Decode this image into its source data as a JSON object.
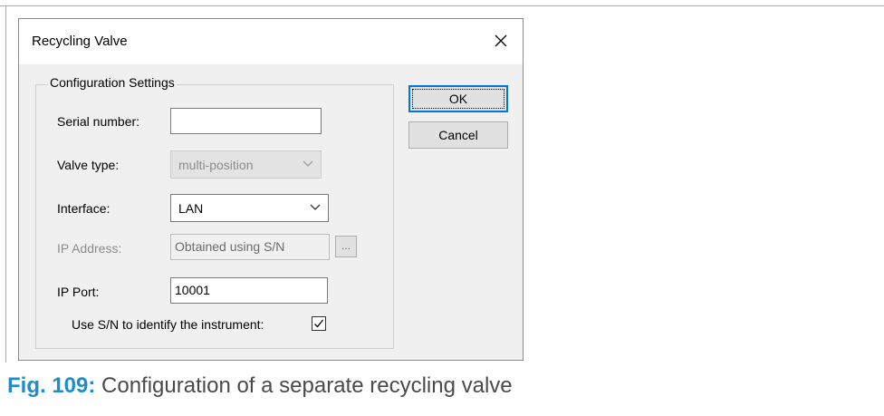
{
  "dialog": {
    "title": "Recycling Valve",
    "group_title": "Configuration Settings",
    "fields": {
      "serial_number": {
        "label": "Serial number:",
        "value": ""
      },
      "valve_type": {
        "label": "Valve type:",
        "value": "multi-position",
        "enabled": false
      },
      "interface": {
        "label": "Interface:",
        "value": "LAN",
        "enabled": true
      },
      "ip_address": {
        "label": "IP Address:",
        "value": "Obtained using S/N",
        "browse_label": "...",
        "enabled": false
      },
      "ip_port": {
        "label": "IP Port:",
        "value": "10001"
      },
      "use_sn": {
        "label": "Use S/N to identify the instrument:",
        "checked": true
      }
    },
    "buttons": {
      "ok": "OK",
      "cancel": "Cancel"
    }
  },
  "caption": {
    "fig_label": "Fig. 109:",
    "text": "Configuration of a separate recycling valve"
  },
  "colors": {
    "accent": "#0078d7",
    "caption_label": "#1f8ec7"
  }
}
